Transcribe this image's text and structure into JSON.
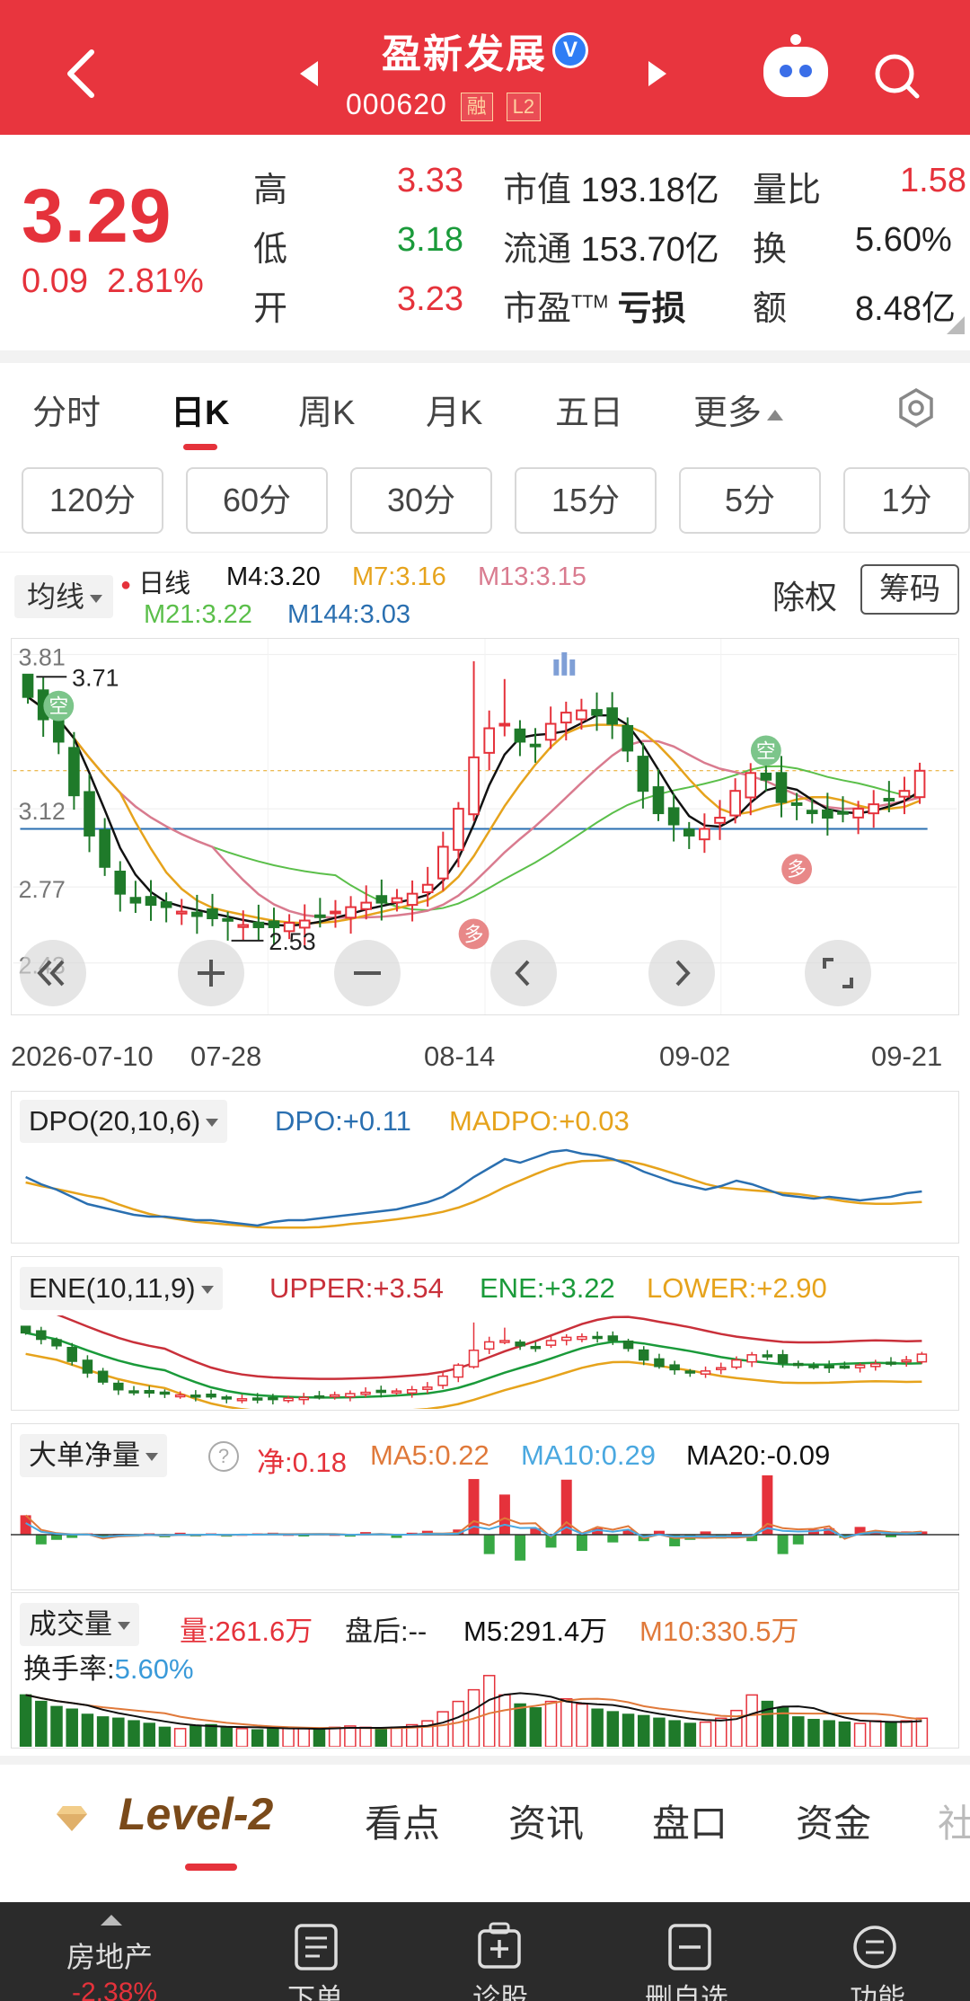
{
  "header": {
    "stock_name": "盈新发展",
    "verified": "V",
    "code": "000620",
    "tag_margin": "融",
    "tag_level": "L2"
  },
  "quote": {
    "price": "3.29",
    "change": "0.09",
    "change_pct": "2.81%",
    "high_label": "高",
    "high": "3.33",
    "low_label": "低",
    "low": "3.18",
    "open_label": "开",
    "open": "3.23",
    "mktcap_label": "市值",
    "mktcap": "193.18亿",
    "float_label": "流通",
    "float": "153.70亿",
    "pe_label": "市盈",
    "pe_suffix": "TTM",
    "pe": "亏损",
    "vol_ratio_label": "量比",
    "vol_ratio": "1.58",
    "turnover_label": "换",
    "turnover": "5.60%",
    "amount_label": "额",
    "amount": "8.48亿"
  },
  "period_tabs": [
    "分时",
    "日K",
    "周K",
    "月K",
    "五日",
    "更多"
  ],
  "minute_buttons": [
    "120分",
    "60分",
    "30分",
    "15分",
    "5分",
    "1分"
  ],
  "ma_legend": {
    "selector": "均线",
    "period": "日线",
    "m4": "M4:3.20",
    "m7": "M7:3.16",
    "m13": "M13:3.15",
    "m21": "M21:3.22",
    "m144": "M144:3.03",
    "fuquan": "除权",
    "chouma": "筹码"
  },
  "kline": {
    "y_ticks": [
      "3.81",
      "3.12",
      "2.77",
      "2.43"
    ],
    "high_mark": "3.71",
    "low_mark": "2.53",
    "signal_short": "空",
    "signal_long": "多",
    "dates": [
      "2026-07-10",
      "07-28",
      "08-14",
      "09-02",
      "09-21"
    ],
    "colors": {
      "up": "#e5323b",
      "down": "#1f7a2a",
      "m4": "#111111",
      "m7": "#e6a31c",
      "m13": "#d97b8f",
      "m21": "#5bbf4a",
      "m144": "#2a6fb0"
    }
  },
  "dpo": {
    "selector": "DPO(20,10,6)",
    "dpo": "DPO:+0.11",
    "madpo": "MADPO:+0.03"
  },
  "ene": {
    "selector": "ENE(10,11,9)",
    "upper": "UPPER:+3.54",
    "ene": "ENE:+3.22",
    "lower": "LOWER:+2.90"
  },
  "big_order": {
    "selector": "大单净量",
    "net": "净:0.18",
    "ma5": "MA5:0.22",
    "ma10": "MA10:0.29",
    "ma20": "MA20:-0.09"
  },
  "volume": {
    "selector": "成交量",
    "vol": "量:261.6万",
    "after": "盘后:--",
    "m5": "M5:291.4万",
    "m10": "M10:330.5万",
    "turnover_label": "换手率:",
    "turnover": "5.60%"
  },
  "info_tabs": {
    "level2": "Level-2",
    "tabs": [
      "看点",
      "资讯",
      "盘口",
      "资金",
      "社"
    ]
  },
  "bottom_bar": {
    "sector": "房地产",
    "sector_change": "-2.38%",
    "items": [
      "下单",
      "诊股",
      "删自选",
      "功能"
    ]
  }
}
